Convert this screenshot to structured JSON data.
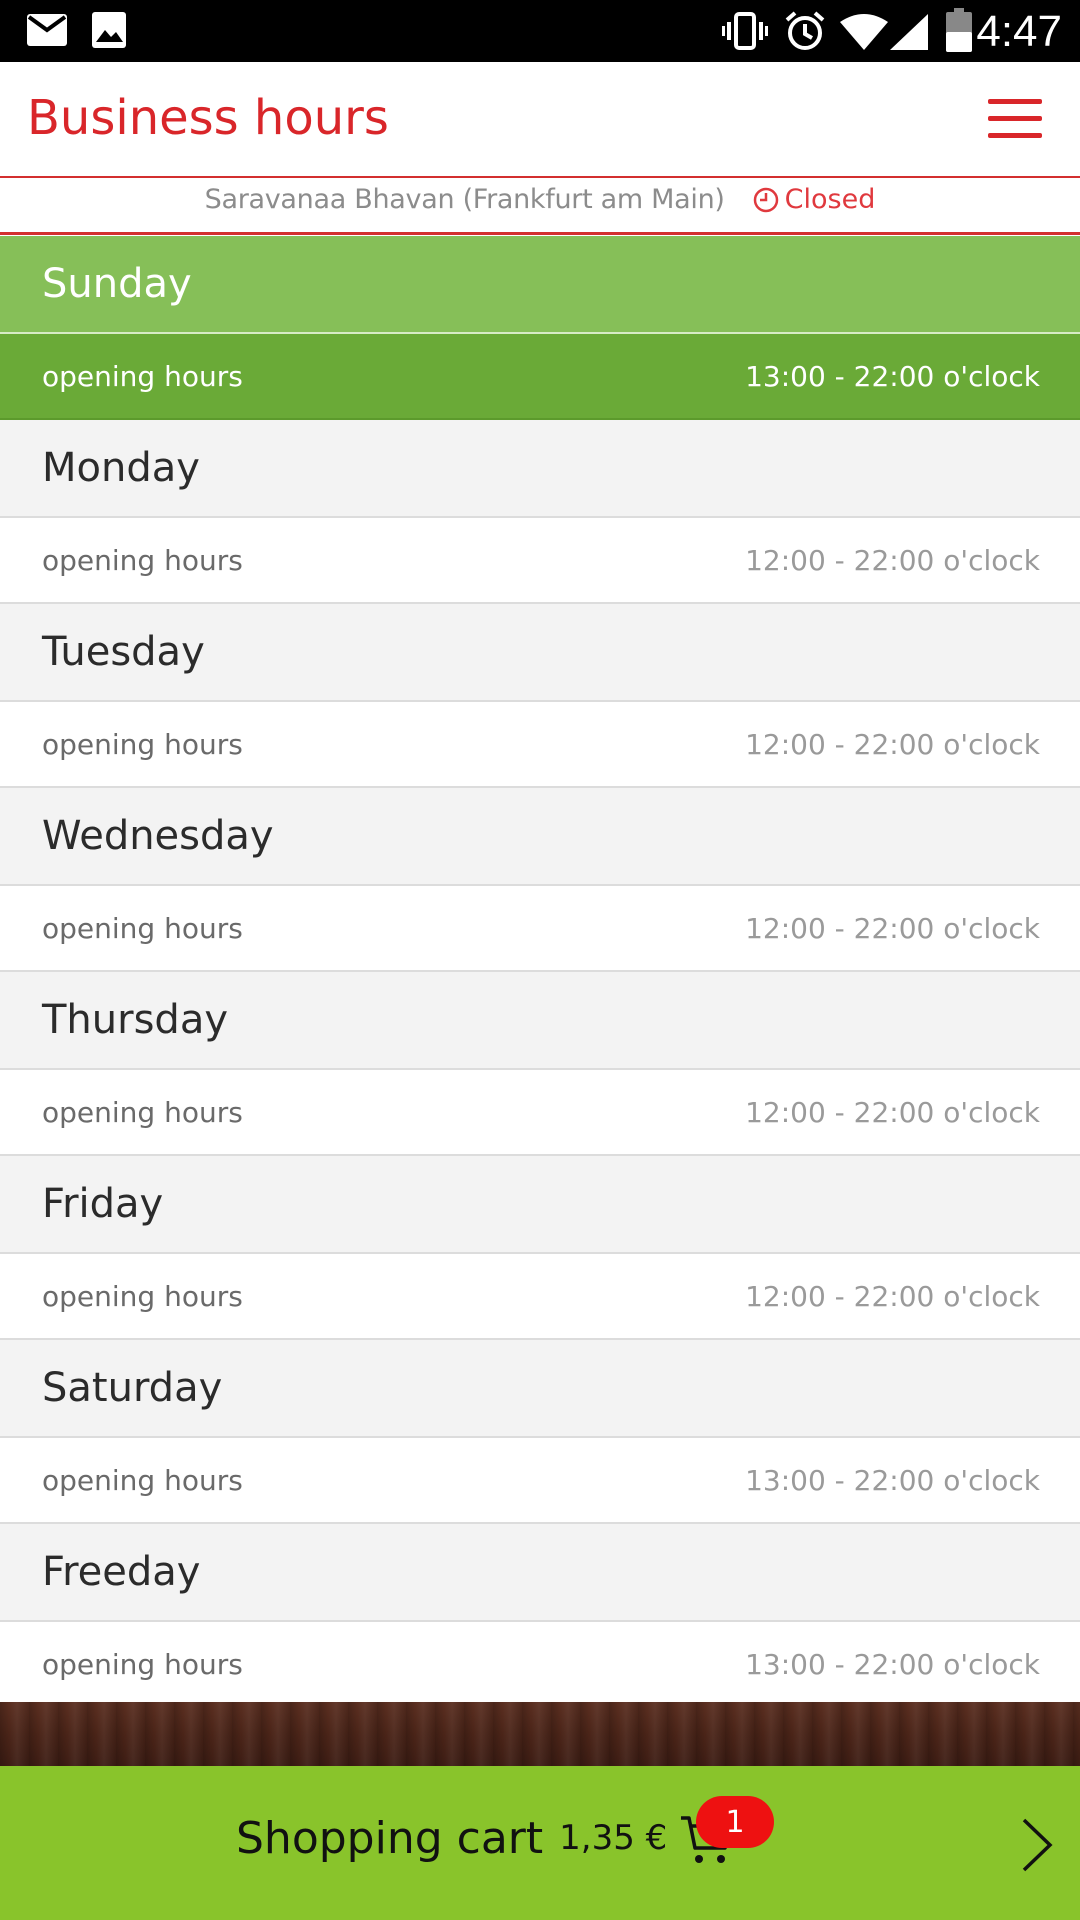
{
  "status_bar": {
    "time": "4:47",
    "icons": [
      "mail-icon",
      "image-icon",
      "vibrate-icon",
      "alarm-icon",
      "wifi-icon",
      "signal-icon",
      "battery-icon"
    ]
  },
  "header": {
    "title": "Business hours",
    "menu_icon": "hamburger-menu-icon",
    "accent_color": "#d9262a"
  },
  "store": {
    "name": "Saravanaa Bhavan (Frankfurt am Main)",
    "status": "Closed",
    "status_icon": "clock-icon"
  },
  "hours": [
    {
      "day": "Sunday",
      "label": "opening hours",
      "time": "13:00 - 22:00 o'clock",
      "highlighted": true
    },
    {
      "day": "Monday",
      "label": "opening hours",
      "time": "12:00 - 22:00 o'clock",
      "highlighted": false
    },
    {
      "day": "Tuesday",
      "label": "opening hours",
      "time": "12:00 - 22:00 o'clock",
      "highlighted": false
    },
    {
      "day": "Wednesday",
      "label": "opening hours",
      "time": "12:00 - 22:00 o'clock",
      "highlighted": false
    },
    {
      "day": "Thursday",
      "label": "opening hours",
      "time": "12:00 - 22:00 o'clock",
      "highlighted": false
    },
    {
      "day": "Friday",
      "label": "opening hours",
      "time": "12:00 - 22:00 o'clock",
      "highlighted": false
    },
    {
      "day": "Saturday",
      "label": "opening hours",
      "time": "13:00 - 22:00 o'clock",
      "highlighted": false
    },
    {
      "day": "Freeday",
      "label": "opening hours",
      "time": "13:00 - 22:00 o'clock",
      "highlighted": false
    }
  ],
  "cart": {
    "label": "Shopping cart",
    "total": "1,35 €",
    "badge_count": "1",
    "icon": "shopping-cart-icon",
    "arrow_icon": "chevron-right-icon",
    "bar_color": "#89c42b",
    "badge_color": "#ee1111"
  },
  "colors": {
    "today_header": "#86bf58",
    "today_row": "#6aaa37"
  }
}
